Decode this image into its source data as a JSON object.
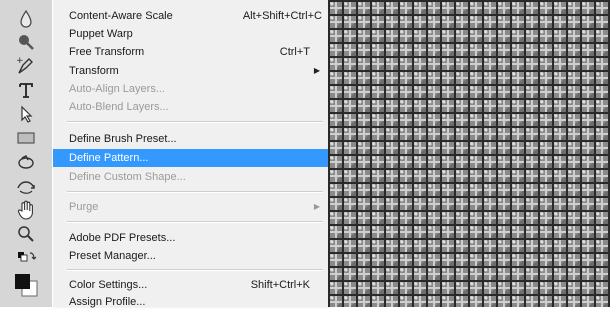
{
  "tools": [
    {
      "icon": "burn-tool-icon"
    },
    {
      "icon": "sponge-tool-icon"
    },
    {
      "icon": "pen-tool-icon"
    },
    {
      "icon": "type-tool-icon"
    },
    {
      "icon": "path-selection-tool-icon"
    },
    {
      "icon": "rectangle-tool-icon"
    },
    {
      "icon": "3d-rotate-tool-icon"
    },
    {
      "icon": "3d-orbit-tool-icon"
    },
    {
      "icon": "hand-tool-icon"
    },
    {
      "icon": "zoom-tool-icon"
    },
    {
      "icon": "default-colors-icon"
    },
    {
      "icon": "color-swatches-icon"
    }
  ],
  "menu": {
    "items": [
      {
        "label": "Content-Aware Scale",
        "shortcut": "Alt+Shift+Ctrl+C",
        "enabled": true
      },
      {
        "label": "Puppet Warp",
        "shortcut": "",
        "enabled": true
      },
      {
        "label": "Free Transform",
        "shortcut": "Ctrl+T",
        "enabled": true
      },
      {
        "label": "Transform",
        "shortcut": "",
        "enabled": true,
        "submenu": true
      },
      {
        "label": "Auto-Align Layers...",
        "shortcut": "",
        "enabled": false
      },
      {
        "label": "Auto-Blend Layers...",
        "shortcut": "",
        "enabled": false
      },
      {
        "label": "Define Brush Preset...",
        "shortcut": "",
        "enabled": true
      },
      {
        "label": "Define Pattern...",
        "shortcut": "",
        "enabled": true,
        "highlighted": true
      },
      {
        "label": "Define Custom Shape...",
        "shortcut": "",
        "enabled": false
      },
      {
        "label": "Purge",
        "shortcut": "",
        "enabled": false,
        "submenu": true
      },
      {
        "label": "Adobe PDF Presets...",
        "shortcut": "",
        "enabled": true
      },
      {
        "label": "Preset Manager...",
        "shortcut": "",
        "enabled": true
      },
      {
        "label": "Color Settings...",
        "shortcut": "Shift+Ctrl+K",
        "enabled": true
      },
      {
        "label": "Assign Profile...",
        "shortcut": "",
        "enabled": true
      }
    ]
  },
  "colors": {
    "highlight": "#3399ff",
    "menu_bg": "#f0f0f0",
    "disabled_text": "#9a9a9a",
    "toolbar_bg": "#d6d6d6"
  }
}
